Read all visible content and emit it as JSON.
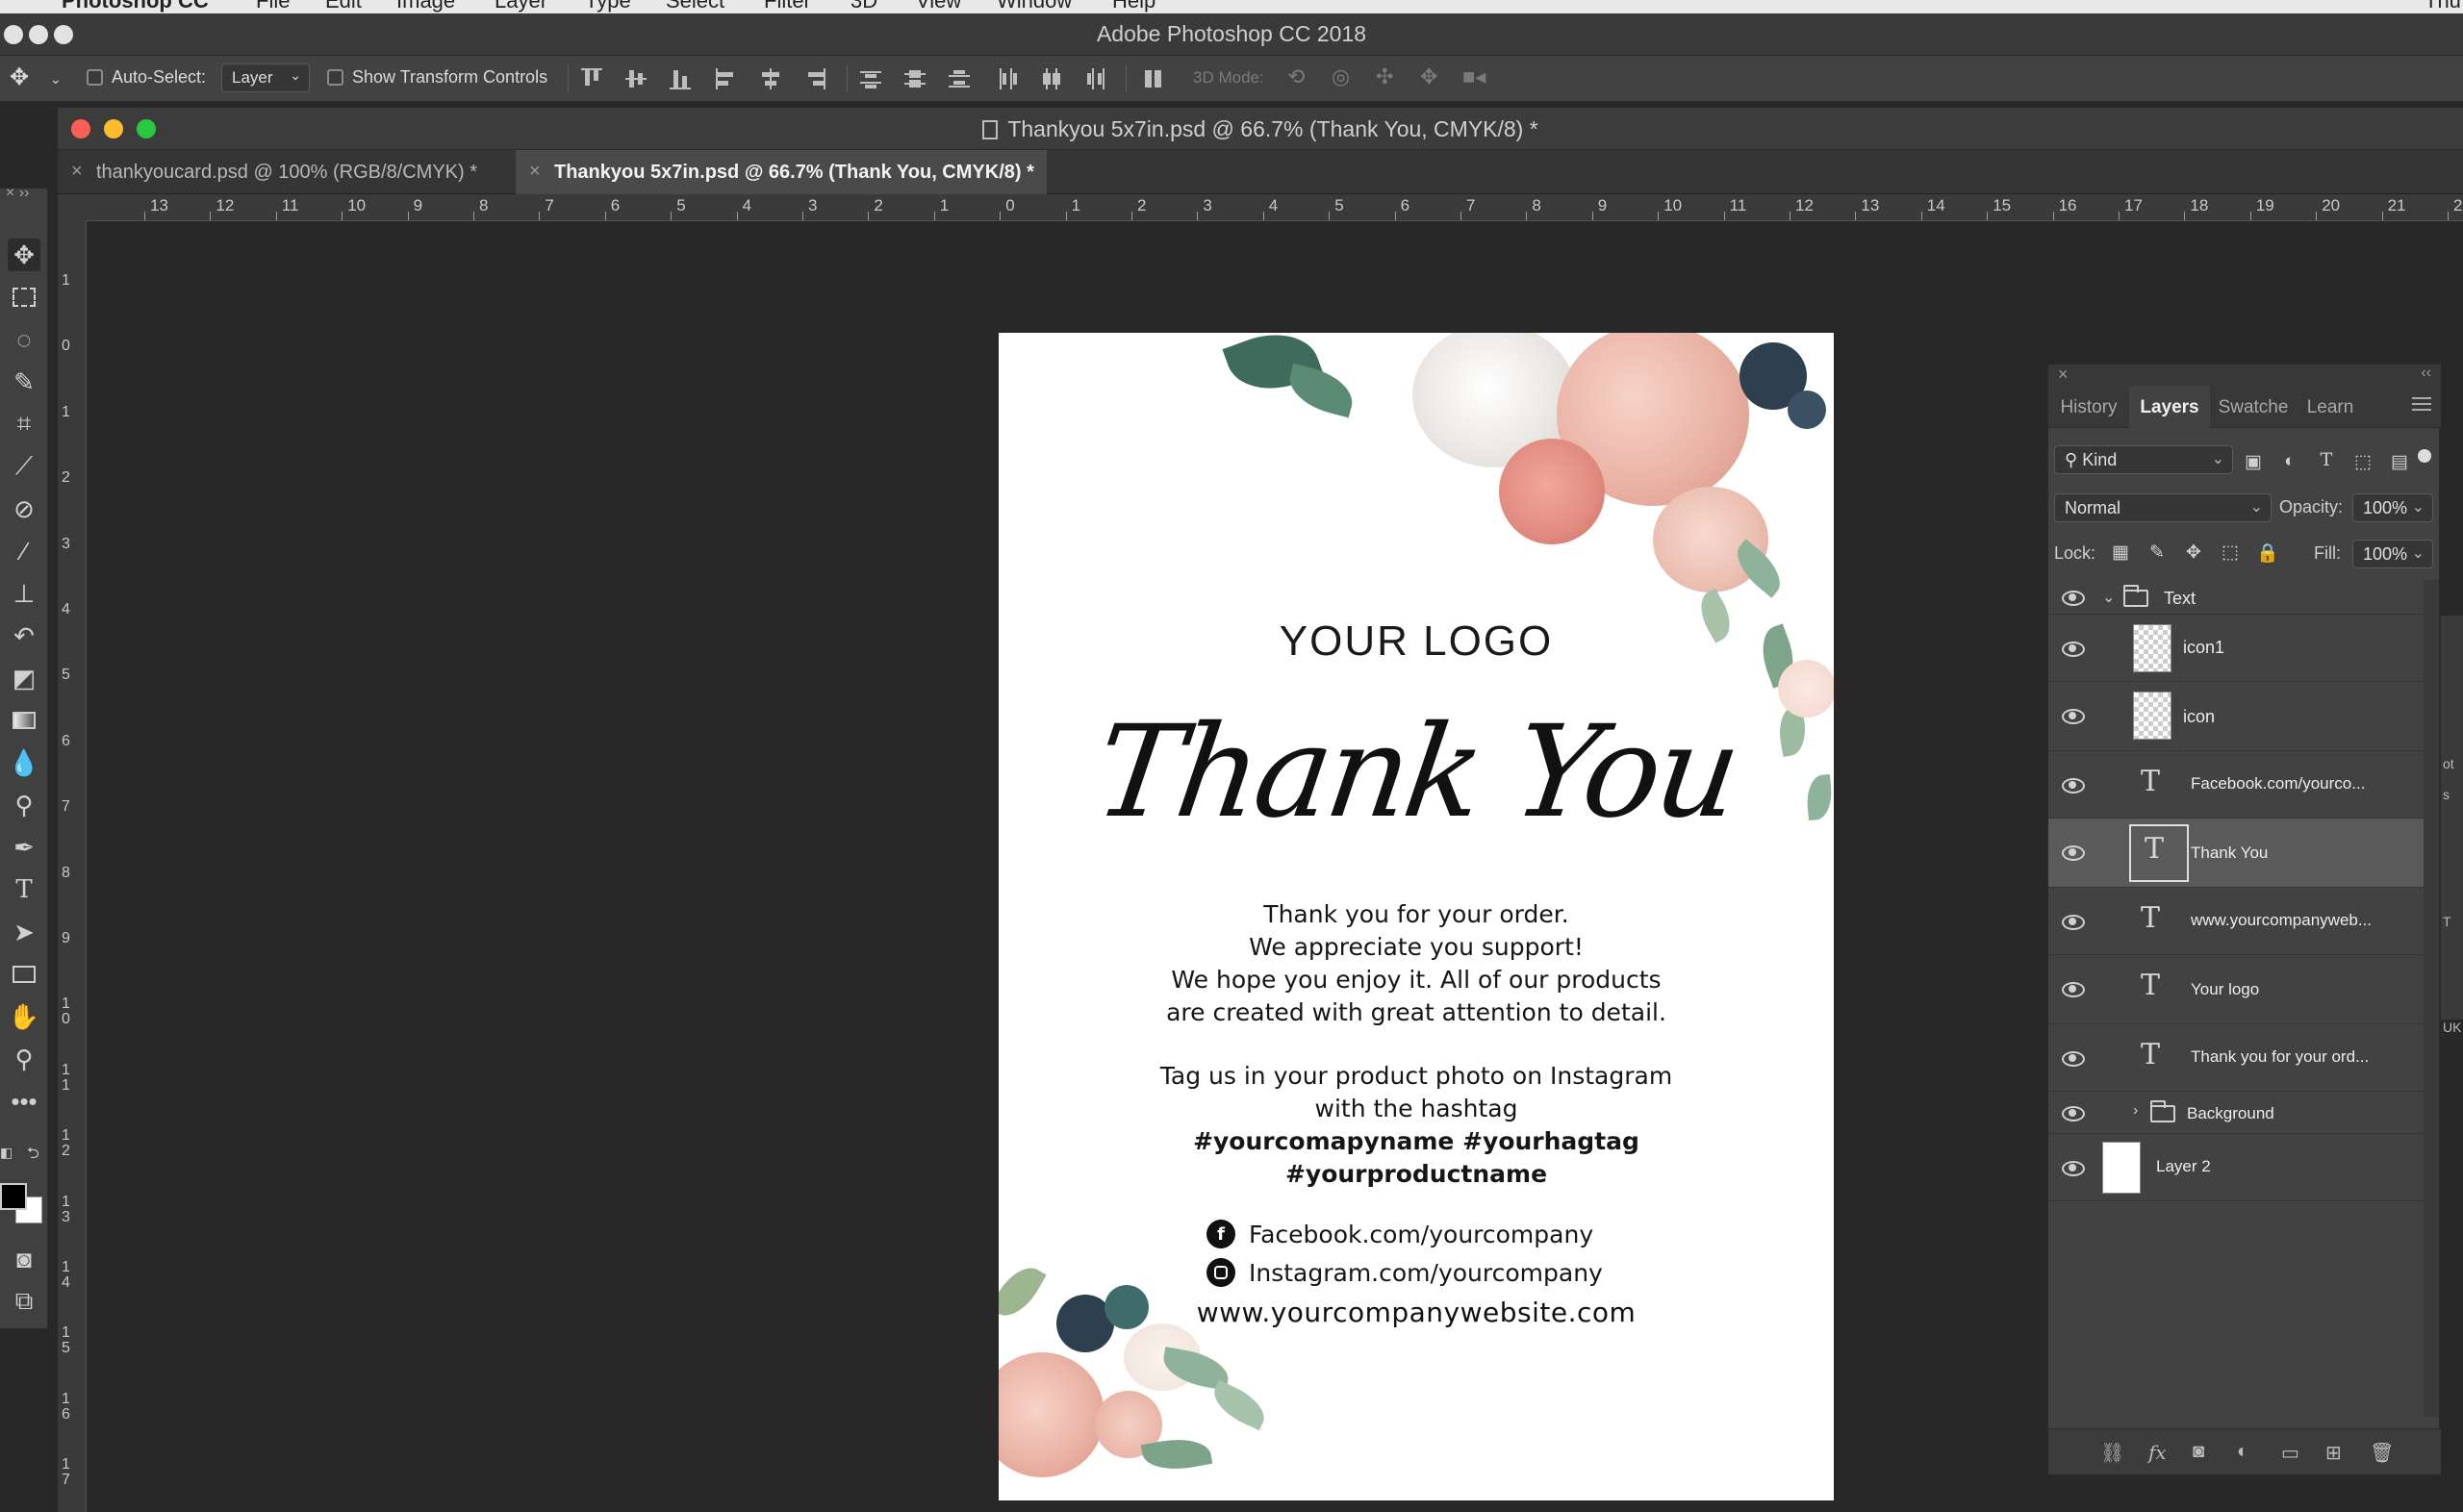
{
  "menubar": {
    "app": "Photoshop CC",
    "items": [
      "File",
      "Edit",
      "Image",
      "Layer",
      "Type",
      "Select",
      "Filter",
      "3D",
      "View",
      "Window",
      "Help"
    ],
    "right_fragment": "Thu"
  },
  "app_title": "Adobe Photoshop CC 2018",
  "options_bar": {
    "auto_select_label": "Auto-Select:",
    "auto_select_checked": false,
    "auto_select_target": "Layer",
    "show_transform_label": "Show Transform Controls",
    "show_transform_checked": false,
    "mode_3d_label": "3D Mode:"
  },
  "document": {
    "window_title": "Thankyou 5x7in.psd @ 66.7% (Thank You, CMYK/8) *",
    "tabs": [
      {
        "label": "thankyoucard.psd @ 100% (RGB/8/CMYK) *",
        "active": false
      },
      {
        "label": "Thankyou 5x7in.psd @ 66.7% (Thank You, CMYK/8) *",
        "active": true
      }
    ],
    "ruler_h": [
      "13",
      "12",
      "11",
      "10",
      "9",
      "8",
      "7",
      "6",
      "5",
      "4",
      "3",
      "2",
      "1",
      "0",
      "1",
      "2",
      "3",
      "4",
      "5",
      "6",
      "7",
      "8",
      "9",
      "10",
      "11",
      "12",
      "13",
      "14",
      "15",
      "16",
      "17",
      "18",
      "19",
      "20",
      "21",
      "22"
    ],
    "ruler_v": [
      "1",
      "0",
      "1",
      "2",
      "3",
      "4",
      "5",
      "6",
      "7",
      "8",
      "9",
      "1 0",
      "1 1",
      "1 2",
      "1 3",
      "1 4",
      "1 5",
      "1 6",
      "1 7"
    ]
  },
  "card": {
    "logo": "YOUR LOGO",
    "headline": "Thank You",
    "body": [
      "Thank you for your order.",
      "We appreciate you support!",
      "We hope you enjoy it. All of our products",
      "are created with great attention to detail."
    ],
    "tag_intro": [
      "Tag us in your product photo on Instagram",
      "with the hashtag"
    ],
    "hashtags": [
      "#yourcomapyname #yourhagtag",
      "#yourproductname"
    ],
    "facebook": "Facebook.com/yourcompany",
    "instagram": "Instagram.com/yourcompany",
    "website": "www.yourcompanywebsite.com",
    "colors": {
      "blush": "#eab3a6",
      "sage": "#8fb39a",
      "teal": "#3f6b6b",
      "navy": "#2e3f4f",
      "cream": "#f3ece4"
    }
  },
  "layers_panel": {
    "tabs": [
      "History",
      "Layers",
      "Swatche",
      "Learn"
    ],
    "active_tab": "Layers",
    "filter_kind": "Kind",
    "blend_mode": "Normal",
    "opacity_label": "Opacity:",
    "opacity": "100%",
    "lock_label": "Lock:",
    "fill_label": "Fill:",
    "fill": "100%",
    "layers": [
      {
        "name": "Text",
        "kind": "group",
        "expanded": true,
        "visible": true
      },
      {
        "name": "icon1",
        "kind": "pixel",
        "visible": true
      },
      {
        "name": "icon",
        "kind": "pixel",
        "visible": true
      },
      {
        "name": "Facebook.com/yourco...",
        "kind": "type",
        "visible": true
      },
      {
        "name": "Thank You",
        "kind": "type",
        "visible": true,
        "selected": true
      },
      {
        "name": "www.yourcompanyweb...",
        "kind": "type",
        "visible": true
      },
      {
        "name": "Your logo",
        "kind": "type",
        "visible": true
      },
      {
        "name": "Thank you for your ord...",
        "kind": "type",
        "visible": true
      },
      {
        "name": "Background",
        "kind": "group",
        "expanded": false,
        "visible": true
      },
      {
        "name": "Layer 2",
        "kind": "pixel-white",
        "visible": true
      }
    ]
  },
  "edge_strip": [
    "ot",
    "s",
    "T",
    "UK"
  ]
}
